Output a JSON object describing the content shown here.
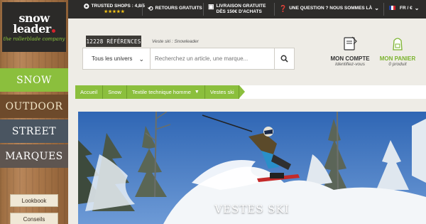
{
  "logo": {
    "name": "snow leader",
    "tagline": "the rollerblade company"
  },
  "sidebar": {
    "categories": [
      {
        "label": "Snow"
      },
      {
        "label": "Outdoor"
      },
      {
        "label": "Street"
      },
      {
        "label": "Marques"
      }
    ],
    "buttons": [
      {
        "label": "Lookbook"
      },
      {
        "label": "Conseils"
      }
    ]
  },
  "topbar": {
    "trusted": "TRUSTED SHOPS : 4,8/5",
    "stars": "★★★★★",
    "returns": "RETOURS GRATUITS",
    "delivery_line1": "LIVRAISON GRATUITE",
    "delivery_line2": "DÈS 150€ D'ACHATS",
    "question": "UNE QUESTION ? NOUS SOMMES LÀ",
    "locale": "FR / €"
  },
  "header": {
    "references": "12228 RÉFÉRENCES",
    "tagline": "Veste ski : Snowleader",
    "universe_select": "Tous les univers",
    "search_placeholder": "Recherchez un article, une marque..."
  },
  "account": {
    "title": "MON COMPTE",
    "subtitle": "Identifiez-vous"
  },
  "cart": {
    "title": "MON PANIER",
    "subtitle": "0 produit"
  },
  "breadcrumb": [
    {
      "label": "Accueil"
    },
    {
      "label": "Snow"
    },
    {
      "label": "Textile technique homme"
    },
    {
      "label": "Vestes ski"
    }
  ],
  "hero": {
    "title": "VESTES SKI"
  },
  "colors": {
    "brand_green": "#8bbf3d",
    "topbar": "#2d2c2a",
    "red_dot": "#d3232c"
  }
}
